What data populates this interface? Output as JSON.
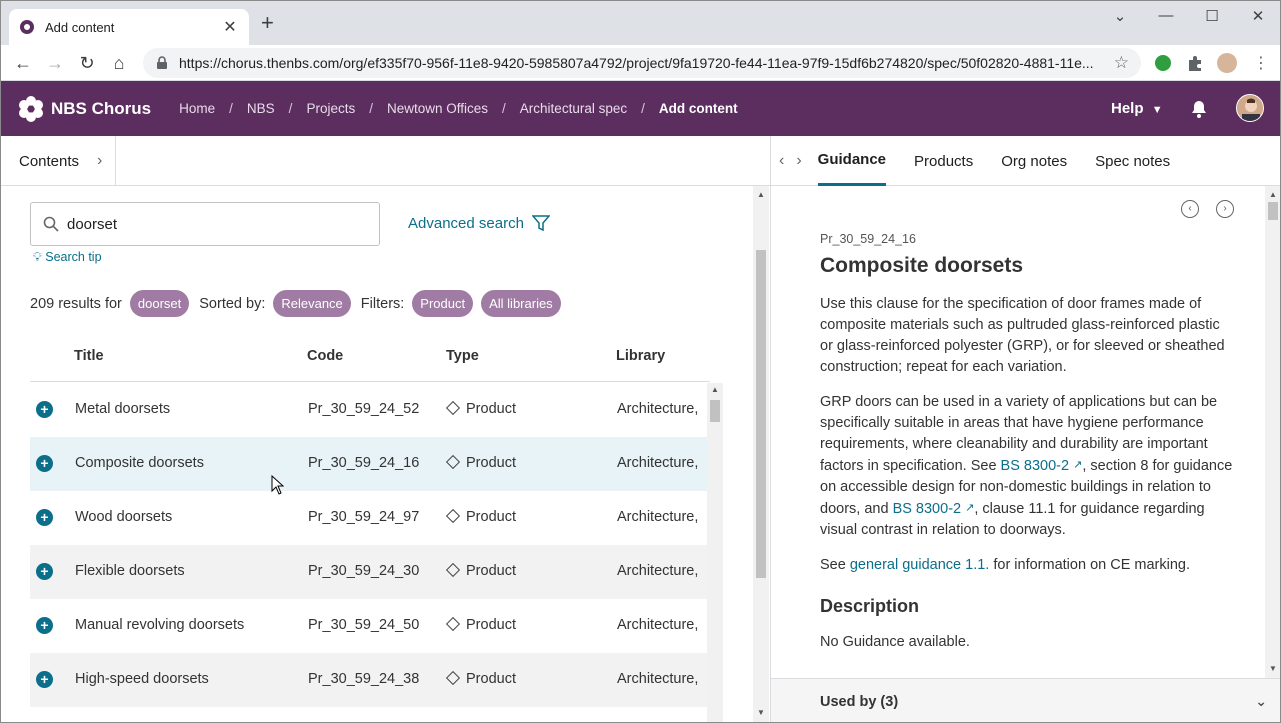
{
  "browser": {
    "tab_title": "Add content",
    "url": "https://chorus.thenbs.com/org/ef335f70-956f-11e8-9420-5985807a4792/project/9fa19720-fe44-11ea-97f9-15df6b274820/spec/50f02820-4881-11e..."
  },
  "app": {
    "name": "NBS Chorus",
    "breadcrumbs": [
      "Home",
      "NBS",
      "Projects",
      "Newtown Offices",
      "Architectural spec",
      "Add content"
    ],
    "help_label": "Help"
  },
  "subbar": {
    "contents_label": "Contents",
    "tabs": [
      "Guidance",
      "Products",
      "Org notes",
      "Spec notes"
    ]
  },
  "search": {
    "value": "doorset",
    "advanced_label": "Advanced search",
    "tip_label": "Search tip"
  },
  "results": {
    "count_text": "209 results for",
    "query_pill": "doorset",
    "sorted_label": "Sorted by:",
    "sort_pill": "Relevance",
    "filters_label": "Filters:",
    "filter_pills": [
      "Product",
      "All libraries"
    ]
  },
  "table": {
    "headers": [
      "Title",
      "Code",
      "Type",
      "Library"
    ],
    "rows": [
      {
        "title": "Metal doorsets",
        "code": "Pr_30_59_24_52",
        "type": "Product",
        "library": "Architecture,"
      },
      {
        "title": "Composite doorsets",
        "code": "Pr_30_59_24_16",
        "type": "Product",
        "library": "Architecture,"
      },
      {
        "title": "Wood doorsets",
        "code": "Pr_30_59_24_97",
        "type": "Product",
        "library": "Architecture,"
      },
      {
        "title": "Flexible doorsets",
        "code": "Pr_30_59_24_30",
        "type": "Product",
        "library": "Architecture,"
      },
      {
        "title": "Manual revolving doorsets",
        "code": "Pr_30_59_24_50",
        "type": "Product",
        "library": "Architecture,"
      },
      {
        "title": "High-speed doorsets",
        "code": "Pr_30_59_24_38",
        "type": "Product",
        "library": "Architecture,"
      }
    ]
  },
  "guidance": {
    "code": "Pr_30_59_24_16",
    "title": "Composite doorsets",
    "para1": "Use this clause for the specification of door frames made of composite materials such as pultruded glass-reinforced plastic or glass-reinforced polyester (GRP), or for sleeved or sheathed construction; repeat for each variation.",
    "para2_a": "GRP doors can be used in a variety of applications but can be specifically suitable in areas that have hygiene performance requirements, where cleanability and durability are important factors in specification. See ",
    "link1": "BS 8300-2",
    "para2_b": ", section 8 for guidance on accessible design for non-domestic buildings in relation to doors, and ",
    "link2": "BS 8300-2",
    "para2_c": ", clause 11.1 for guidance regarding visual contrast in relation to doorways.",
    "para3_a": "See ",
    "link3": "general guidance 1.1.",
    "para3_b": " for information on CE marking.",
    "description_heading": "Description",
    "description_text": "No Guidance available.",
    "used_by": "Used by (3)"
  },
  "colors": {
    "brand": "#5c2e5f",
    "accent": "#0b6e8a",
    "pill": "#a07ba3"
  }
}
